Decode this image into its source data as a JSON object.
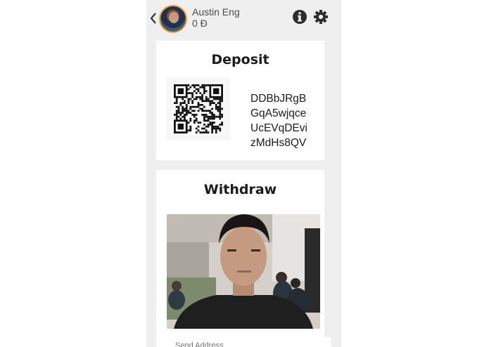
{
  "header": {
    "back_icon": "chevron-left-icon",
    "user_name": "Austin Eng",
    "balance": "0 Đ",
    "info_icon": "info-circle-icon",
    "settings_icon": "gear-icon"
  },
  "deposit": {
    "title": "Deposit",
    "address_lines": [
      "DDBbJRgB",
      "GqA5wjqce",
      "UcEVqDEvi",
      "zMdHs8QV"
    ]
  },
  "withdraw": {
    "title": "Withdraw",
    "send_placeholder": "Send Address"
  },
  "colors": {
    "background": "#efefef",
    "card": "#ffffff",
    "text": "#1b1b1b",
    "avatar_ring": "#f0a040"
  }
}
